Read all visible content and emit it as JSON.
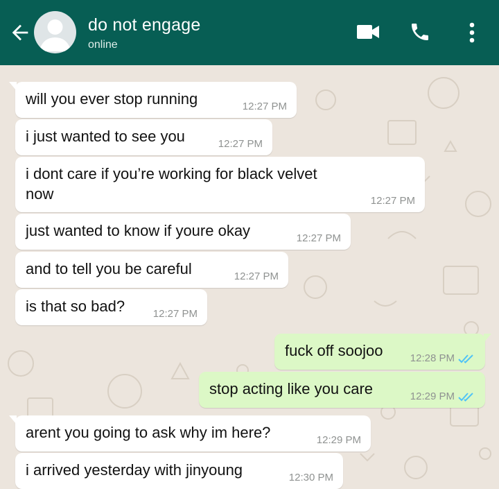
{
  "header": {
    "contact_name": "do not engage",
    "status": "online",
    "colors": {
      "bar": "#075e54",
      "incoming": "#ffffff",
      "outgoing": "#dcf8c6",
      "wallpaper": "#ece5dd",
      "tick": "#4fc3f7"
    },
    "icons": [
      "back-arrow-icon",
      "avatar",
      "video-call-icon",
      "phone-icon",
      "more-vert-icon"
    ]
  },
  "messages": [
    {
      "text": "will you ever stop running",
      "time": "12:27 PM",
      "direction": "in"
    },
    {
      "text": "i just wanted to see you",
      "time": "12:27 PM",
      "direction": "in"
    },
    {
      "text": "i dont care if you’re working for black velvet\nnow",
      "time": "12:27 PM",
      "direction": "in"
    },
    {
      "text": "just wanted to know if youre okay",
      "time": "12:27 PM",
      "direction": "in"
    },
    {
      "text": "and to tell you be careful",
      "time": "12:27 PM",
      "direction": "in"
    },
    {
      "text": "is that so bad?",
      "time": "12:27 PM",
      "direction": "in"
    },
    {
      "text": "fuck off soojoo",
      "time": "12:28 PM",
      "direction": "out",
      "status": "read"
    },
    {
      "text": "stop acting like you care",
      "time": "12:29 PM",
      "direction": "out",
      "status": "read"
    },
    {
      "text": "arent you going to ask why im here?",
      "time": "12:29 PM",
      "direction": "in"
    },
    {
      "text": "i arrived yesterday with jinyoung",
      "time": "12:30 PM",
      "direction": "in"
    }
  ]
}
